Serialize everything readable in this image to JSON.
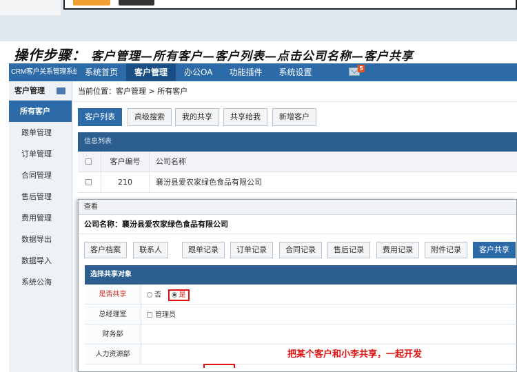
{
  "instruction": {
    "prefix": "操作步骤：",
    "text": "客户管理—所有客户—客户列表—点击公司名称—客户共享"
  },
  "topbar": {
    "brand": "CRM客户关系管理系统",
    "nav": [
      "系统首页",
      "客户管理",
      "办公OA",
      "功能插件",
      "系统设置"
    ],
    "active_nav": "客户管理",
    "mail_count": "5"
  },
  "sidebar": {
    "title": "客户管理",
    "items": [
      "所有客户",
      "跟单管理",
      "订单管理",
      "合同管理",
      "售后管理",
      "费用管理",
      "数据导出",
      "数据导入",
      "系统公海"
    ],
    "active": "所有客户"
  },
  "main": {
    "breadcrumb_label": "当前位置：",
    "breadcrumb_path": "客户管理 > 所有客户",
    "tabs": [
      "客户列表",
      "高级搜索",
      "我的共享",
      "共享给我",
      "新增客户"
    ],
    "panel_title": "信息列表",
    "columns": [
      "客户编号",
      "公司名称"
    ],
    "rows": [
      {
        "code": "210",
        "name": "襄汾县爱农家绿色食品有限公司"
      }
    ]
  },
  "dialog": {
    "title": "查看",
    "company_label": "公司名称：",
    "company_name": "襄汾县爱农家绿色食品有限公司",
    "tabs": [
      "客户档案",
      "联系人",
      "跟单记录",
      "订单记录",
      "合同记录",
      "售后记录",
      "费用记录",
      "附件记录",
      "客户共享"
    ],
    "active_tab": "客户共享",
    "share_section_title": "选择共享对象",
    "share_rows": {
      "is_share_label": "是否共享",
      "opt_no": "否",
      "opt_yes": "是",
      "gm_office_label": "总经理室",
      "gm_option": "管理员",
      "finance_label": "财务部",
      "hr_label": "人力资源部"
    },
    "annotation": "把某个客户和小李共享，一起开发"
  },
  "colors": {
    "nav_blue": "#2c6aa8",
    "panel_blue": "#2c5e90",
    "highlight_red": "#e01010"
  }
}
